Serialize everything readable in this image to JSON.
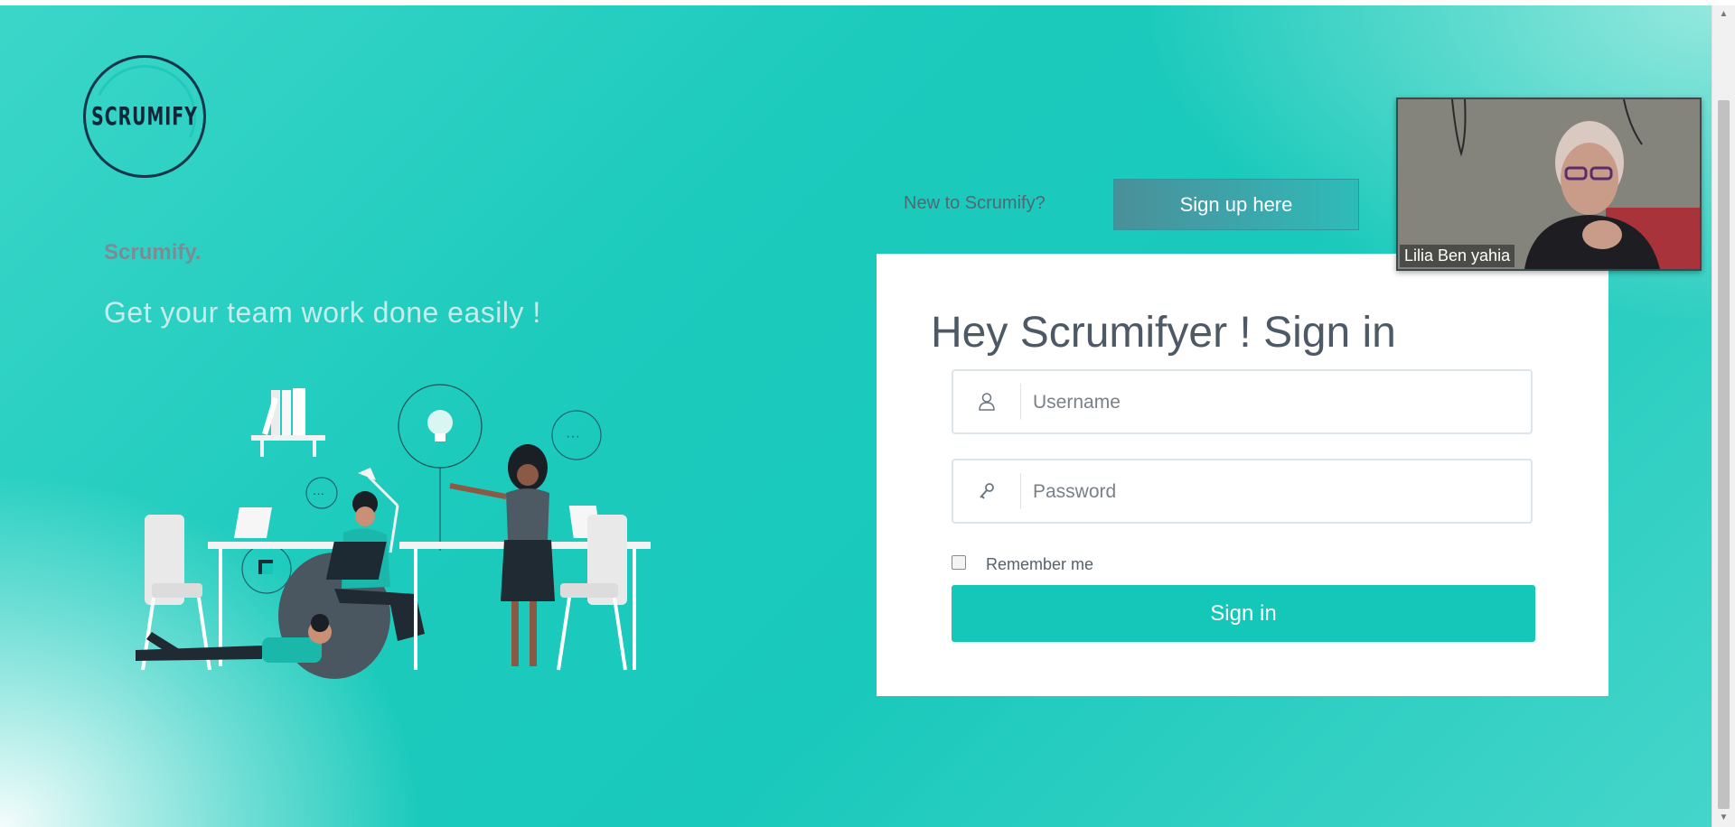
{
  "brand": {
    "logo_text": "SCRUMIFY",
    "name": "Scrumify.",
    "tagline": "Get your team work done easily !"
  },
  "signup": {
    "prompt": "New to Scrumify?",
    "button_label": "Sign up here"
  },
  "login": {
    "title": "Hey Scrumifyer ! Sign in",
    "username_placeholder": "Username",
    "password_placeholder": "Password",
    "remember_label": "Remember me",
    "remember_checked": false,
    "submit_label": "Sign in"
  },
  "video_call": {
    "participant_name": "Lilia Ben yahia"
  },
  "icons": {
    "username": "user-icon",
    "password": "key-icon",
    "scroll_up": "scroll-up-arrow-icon",
    "scroll_down": "scroll-down-arrow-icon"
  },
  "colors": {
    "accent": "#15c7b9",
    "background": "#1dcbbd",
    "logo_outline": "#15364a",
    "signup_button": "#3aa9ad"
  }
}
